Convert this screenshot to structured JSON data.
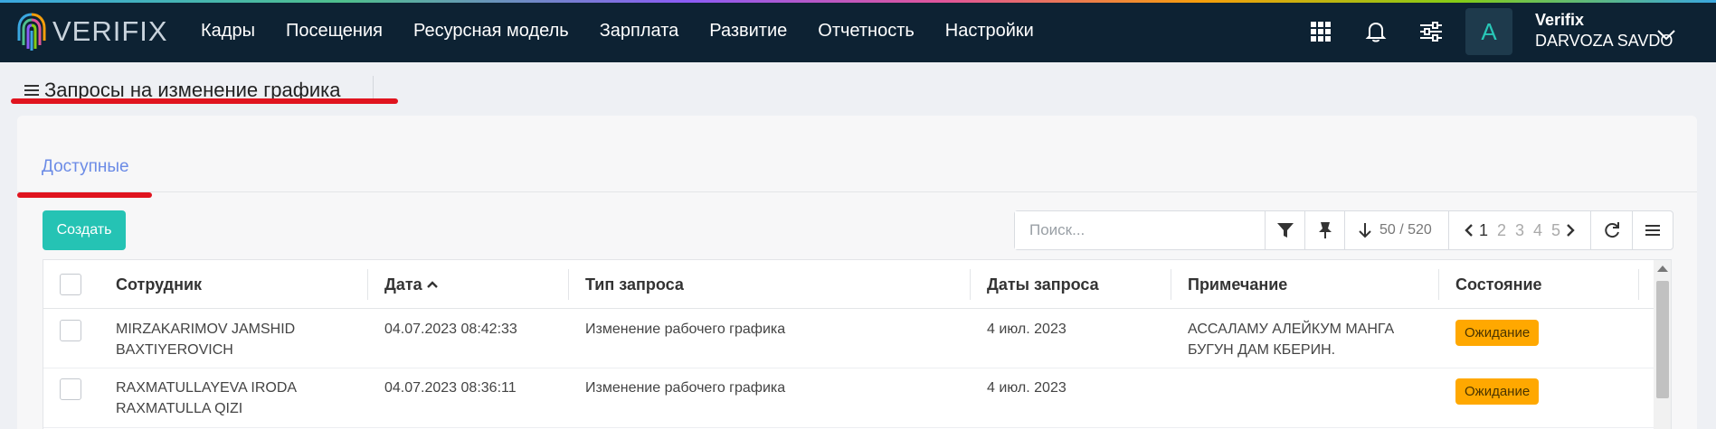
{
  "app": {
    "logo_text": "VERIFIX",
    "menu": [
      "Кадры",
      "Посещения",
      "Ресурсная модель",
      "Зарплата",
      "Развитие",
      "Отчетность",
      "Настройки"
    ],
    "icons": [
      "apps-grid-icon",
      "bell-icon",
      "sliders-icon"
    ],
    "user": {
      "avatar_letter": "A",
      "name": "Verifix",
      "company": "DARVOZA SAVDO"
    }
  },
  "page": {
    "title": "Запросы на изменение графика",
    "tab": "Доступные",
    "create_label": "Создать"
  },
  "toolbar": {
    "search_placeholder": "Поиск...",
    "count": "50 / 520",
    "pages": [
      "1",
      "2",
      "3",
      "4",
      "5"
    ],
    "active_page": "1"
  },
  "table": {
    "columns": [
      "Сотрудник",
      "Дата",
      "Тип запроса",
      "Даты запроса",
      "Примечание",
      "Состояние"
    ],
    "sorted_column": "Дата",
    "rows": [
      {
        "employee": [
          "MIRZAKARIMOV JAMSHID",
          "BAXTIYEROVICH"
        ],
        "date": "04.07.2023 08:42:33",
        "type": "Изменение рабочего графика",
        "request_dates": "4 июл. 2023",
        "note": [
          "АССАЛАМУ АЛЕЙКУМ МАНГА",
          "БУГУН ДАМ КБЕРИН."
        ],
        "status": "Ожидание"
      },
      {
        "employee": [
          "RAXMATULLAYEVA IRODA",
          "RAXMATULLA QIZI"
        ],
        "date": "04.07.2023 08:36:11",
        "type": "Изменение рабочего графика",
        "request_dates": "4 июл. 2023",
        "note": [
          "",
          ""
        ],
        "status": "Ожидание"
      }
    ]
  },
  "colors": {
    "navbar": "#0d2233",
    "accent": "#25c3b4",
    "tab": "#6b8be6",
    "status_pending": "#ffa800",
    "annotation": "#e0141f"
  }
}
